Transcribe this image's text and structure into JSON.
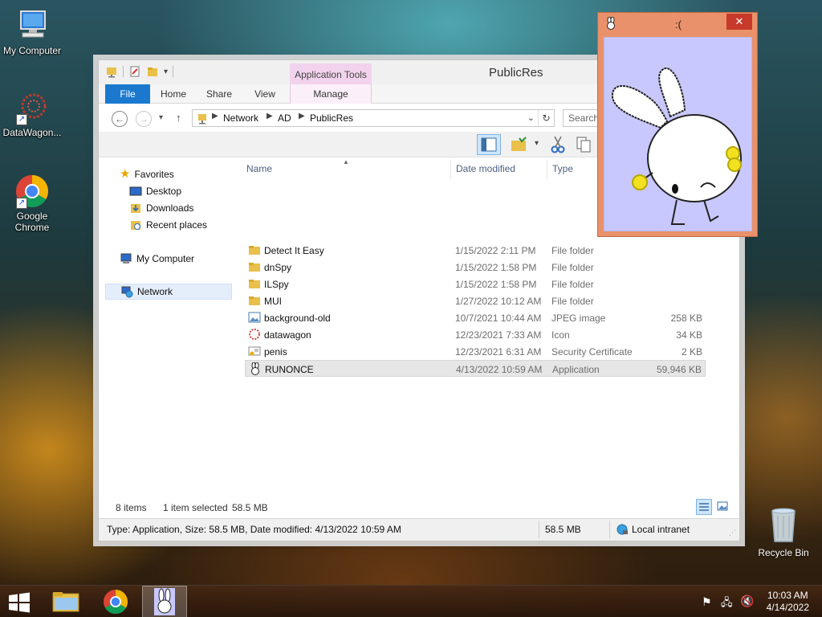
{
  "desktop": {
    "icons": [
      {
        "label": "My Computer"
      },
      {
        "label": "DataWagon..."
      },
      {
        "label": "Google Chrome"
      },
      {
        "label": "Recycle Bin"
      }
    ]
  },
  "explorer": {
    "title": "PublicRes",
    "context_tab_header": "Application Tools",
    "tabs": {
      "file": "File",
      "home": "Home",
      "share": "Share",
      "view": "View",
      "manage": "Manage"
    },
    "address": {
      "crumbs": [
        "Network",
        "AD",
        "PublicRes"
      ]
    },
    "search_placeholder": "Search",
    "nav": {
      "favorites": "Favorites",
      "desktop": "Desktop",
      "downloads": "Downloads",
      "recent": "Recent places",
      "my_computer": "My Computer",
      "network": "Network"
    },
    "columns": {
      "name": "Name",
      "date": "Date modified",
      "type": "Type"
    },
    "files": [
      {
        "name": "Detect It Easy",
        "date": "1/15/2022 2:11 PM",
        "type": "File folder",
        "size": ""
      },
      {
        "name": "dnSpy",
        "date": "1/15/2022 1:58 PM",
        "type": "File folder",
        "size": ""
      },
      {
        "name": "ILSpy",
        "date": "1/15/2022 1:58 PM",
        "type": "File folder",
        "size": ""
      },
      {
        "name": "MUI",
        "date": "1/27/2022 10:12 AM",
        "type": "File folder",
        "size": ""
      },
      {
        "name": "background-old",
        "date": "10/7/2021 10:44 AM",
        "type": "JPEG image",
        "size": "258 KB"
      },
      {
        "name": "datawagon",
        "date": "12/23/2021 7:33 AM",
        "type": "Icon",
        "size": "34 KB"
      },
      {
        "name": "penis",
        "date": "12/23/2021 6:31 AM",
        "type": "Security Certificate",
        "size": "2 KB"
      },
      {
        "name": "RUNONCE",
        "date": "4/13/2022 10:59 AM",
        "type": "Application",
        "size": "59,946 KB"
      }
    ],
    "status": {
      "items": "8 items",
      "selected": "1 item selected",
      "selected_size": "58.5 MB"
    },
    "details_bar": {
      "info": "Type: Application, Size: 58.5 MB, Date modified: 4/13/2022 10:59 AM",
      "size": "58.5 MB",
      "zone": "Local intranet"
    }
  },
  "popup": {
    "title": ":(",
    "close": "✕"
  },
  "taskbar": {
    "time": "10:03 AM",
    "date": "4/14/2022"
  },
  "colors": {
    "accent": "#1a79cf",
    "popup_frame": "#e9916a",
    "popup_bg": "#c8c8ff",
    "context_tab": "#f2d3ee"
  }
}
